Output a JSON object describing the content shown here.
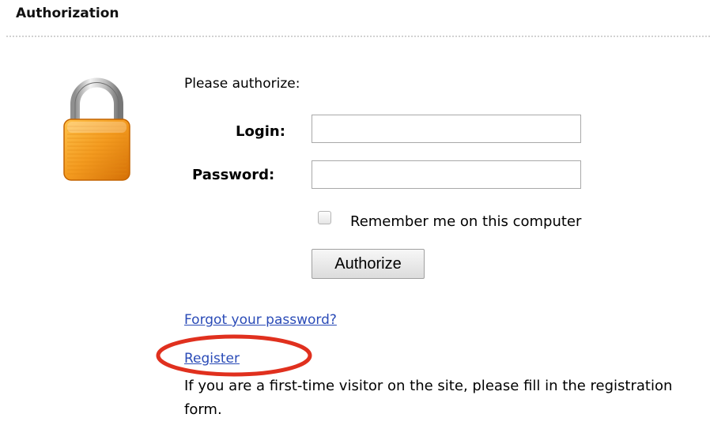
{
  "header": {
    "title": "Authorization"
  },
  "form": {
    "prompt": "Please authorize:",
    "login_label": "Login:",
    "login_value": "",
    "password_label": "Password:",
    "password_value": "",
    "remember_label": "Remember me on this computer",
    "remember_checked": false,
    "authorize_label": "Authorize"
  },
  "links": {
    "forgot_password": "Forgot your password?",
    "register": "Register",
    "register_note": "If you are a first-time visitor on the site, please fill in the registration form."
  },
  "icons": {
    "lock": "lock-icon"
  },
  "colors": {
    "link": "#2a4bb7",
    "highlight": "#e0301e",
    "lock_body": "#f39a1f"
  }
}
